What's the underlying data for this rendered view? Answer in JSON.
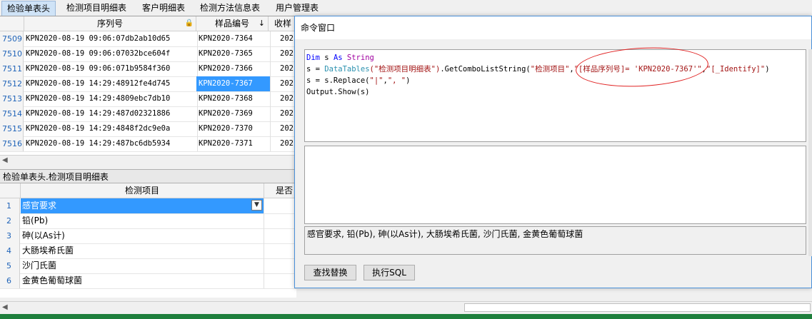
{
  "tabs": [
    "检验单表头",
    "检测项目明细表",
    "客户明细表",
    "检测方法信息表",
    "用户管理表"
  ],
  "top_grid": {
    "headers": [
      "序列号",
      "样品编号",
      "收样"
    ],
    "lock_icon": "lock-icon",
    "sort_icon": "sort-down-arrow",
    "rows": [
      {
        "n": "7509",
        "serial": "KPN2020-08-19 09:06:07db2ab10d65",
        "sample": "KPN2020-7364",
        "recv": "202"
      },
      {
        "n": "7510",
        "serial": "KPN2020-08-19 09:06:07032bce604f",
        "sample": "KPN2020-7365",
        "recv": "202"
      },
      {
        "n": "7511",
        "serial": "KPN2020-08-19 09:06:071b9584f360",
        "sample": "KPN2020-7366",
        "recv": "202"
      },
      {
        "n": "7512",
        "serial": "KPN2020-08-19 14:29:48912fe4d745",
        "sample": "KPN2020-7367",
        "recv": "202"
      },
      {
        "n": "7513",
        "serial": "KPN2020-08-19 14:29:4809ebc7db10",
        "sample": "KPN2020-7368",
        "recv": "202"
      },
      {
        "n": "7514",
        "serial": "KPN2020-08-19 14:29:487d02321886",
        "sample": "KPN2020-7369",
        "recv": "202"
      },
      {
        "n": "7515",
        "serial": "KPN2020-08-19 14:29:4848f2dc9e0a",
        "sample": "KPN2020-7370",
        "recv": "202"
      },
      {
        "n": "7516",
        "serial": "KPN2020-08-19 14:29:487bc6db5934",
        "sample": "KPN2020-7371",
        "recv": "202"
      }
    ]
  },
  "split_label": "检验单表头.检测项目明细表",
  "bottom_grid": {
    "headers": [
      "检测项目",
      "是否"
    ],
    "rows": [
      {
        "n": "1",
        "item": "感官要求"
      },
      {
        "n": "2",
        "item": "铅(Pb)"
      },
      {
        "n": "3",
        "item": "砷(以As计)"
      },
      {
        "n": "4",
        "item": "大肠埃希氏菌"
      },
      {
        "n": "5",
        "item": "沙门氏菌"
      },
      {
        "n": "6",
        "item": "金黄色葡萄球菌"
      }
    ]
  },
  "dialog": {
    "title": "命令窗口",
    "code": {
      "l1_kw1": "Dim",
      "l1_var": " s ",
      "l1_kw2": "As",
      "l1_type": " String",
      "l2_a": "s = ",
      "l2_fn": "DataTables",
      "l2_s1": "(\"检测项目明细表\")",
      "l2_b": ".GetComboListString(",
      "l2_s2": "\"检测项目\"",
      "l2_c": ",",
      "l2_s3": "\"[样品序列号]= 'KPN2020-7367'\"",
      "l2_d": ",",
      "l2_s4": "\"[_Identify]\"",
      "l2_e": ")",
      "l3_a": "s = s.Replace(",
      "l3_s1": "\"|\"",
      "l3_b": ",",
      "l3_s2": "\", \"",
      "l3_c": ")",
      "l4": "Output.Show(s)"
    },
    "output": "感官要求, 铅(Pb), 砷(以As计), 大肠埃希氏菌, 沙门氏菌, 金黄色葡萄球菌",
    "buttons": [
      "查找替换",
      "执行SQL"
    ]
  }
}
